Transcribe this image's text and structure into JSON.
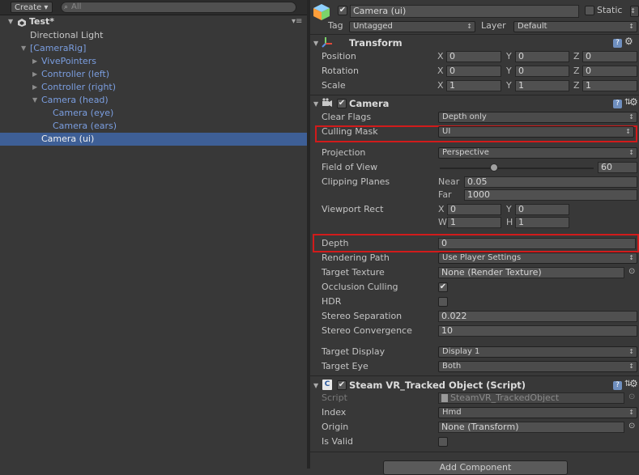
{
  "hierarchy": {
    "create_label": "Create",
    "search_placeholder": "All",
    "scene_name": "Test*",
    "items": [
      {
        "label": "Directional Light"
      },
      {
        "label": "[CameraRig]"
      },
      {
        "label": "VivePointers"
      },
      {
        "label": "Controller (left)"
      },
      {
        "label": "Controller (right)"
      },
      {
        "label": "Camera (head)"
      },
      {
        "label": "Camera (eye)"
      },
      {
        "label": "Camera (ears)"
      },
      {
        "label": "Camera (ui)"
      }
    ]
  },
  "inspector": {
    "object_name": "Camera (ui)",
    "static_label": "Static",
    "tag_label": "Tag",
    "tag_value": "Untagged",
    "layer_label": "Layer",
    "layer_value": "Default",
    "transform": {
      "title": "Transform",
      "position_label": "Position",
      "rotation_label": "Rotation",
      "scale_label": "Scale",
      "x_label": "X",
      "y_label": "Y",
      "z_label": "Z",
      "position": [
        "0",
        "0",
        "0"
      ],
      "rotation": [
        "0",
        "0",
        "0"
      ],
      "scale": [
        "1",
        "1",
        "1"
      ]
    },
    "camera": {
      "title": "Camera",
      "clear_flags_label": "Clear Flags",
      "clear_flags_value": "Depth only",
      "culling_mask_label": "Culling Mask",
      "culling_mask_value": "UI",
      "projection_label": "Projection",
      "projection_value": "Perspective",
      "fov_label": "Field of View",
      "fov_value": "60",
      "fov_slider_fraction": 0.35,
      "clipping_label": "Clipping Planes",
      "near_label": "Near",
      "near_value": "0.05",
      "far_label": "Far",
      "far_value": "1000",
      "viewport_label": "Viewport Rect",
      "w_label": "W",
      "h_label": "H",
      "vp_x": "0",
      "vp_y": "0",
      "vp_w": "1",
      "vp_h": "1",
      "depth_label": "Depth",
      "depth_value": "0",
      "rendering_path_label": "Rendering Path",
      "rendering_path_value": "Use Player Settings",
      "target_texture_label": "Target Texture",
      "target_texture_value": "None (Render Texture)",
      "occlusion_label": "Occlusion Culling",
      "hdr_label": "HDR",
      "stereo_sep_label": "Stereo Separation",
      "stereo_sep_value": "0.022",
      "stereo_conv_label": "Stereo Convergence",
      "stereo_conv_value": "10",
      "target_display_label": "Target Display",
      "target_display_value": "Display 1",
      "target_eye_label": "Target Eye",
      "target_eye_value": "Both"
    },
    "tracked": {
      "title": "Steam VR_Tracked Object (Script)",
      "script_label": "Script",
      "script_value": "SteamVR_TrackedObject",
      "index_label": "Index",
      "index_value": "Hmd",
      "origin_label": "Origin",
      "origin_value": "None (Transform)",
      "is_valid_label": "Is Valid"
    },
    "add_component_label": "Add Component"
  },
  "colors": {
    "selection": "#3e5f96",
    "highlight_box": "#d11b1b",
    "prefab_blue": "#7b9ee0"
  }
}
